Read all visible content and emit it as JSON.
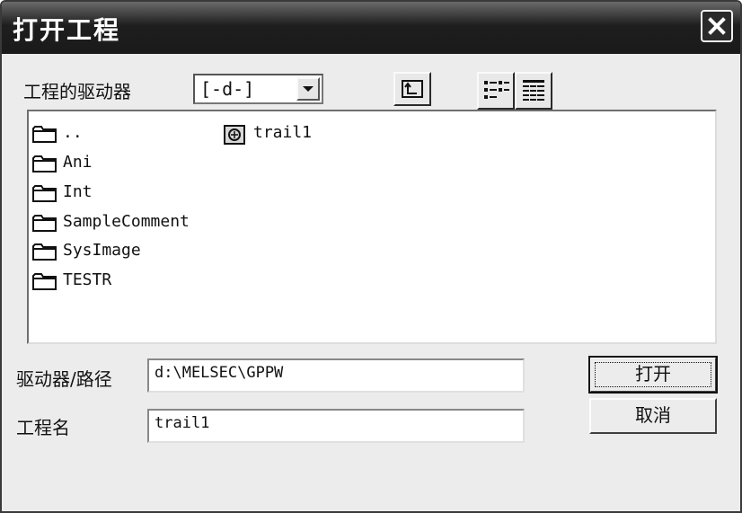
{
  "window": {
    "title": "打开工程",
    "close_icon": "close-icon"
  },
  "drive_label": "工程的驱动器",
  "drive_select": {
    "value": "[-d-]"
  },
  "toolbar": {
    "up_folder_icon": "up-folder-icon",
    "list_view_icon": "list-view-icon",
    "detail_view_icon": "detail-view-icon"
  },
  "files": [
    {
      "name": "..",
      "icon": "folder-icon"
    },
    {
      "name": "Ani",
      "icon": "folder-icon"
    },
    {
      "name": "Int",
      "icon": "folder-icon"
    },
    {
      "name": "SampleComment",
      "icon": "folder-icon"
    },
    {
      "name": "SysImage",
      "icon": "folder-icon"
    },
    {
      "name": "TESTR",
      "icon": "folder-icon"
    },
    {
      "name": "trail1",
      "icon": "project-icon"
    }
  ],
  "path": {
    "label": "驱动器/路径",
    "value": "d:\\MELSEC\\GPPW"
  },
  "project": {
    "label": "工程名",
    "value": "trail1"
  },
  "buttons": {
    "open": "打开",
    "cancel": "取消"
  }
}
